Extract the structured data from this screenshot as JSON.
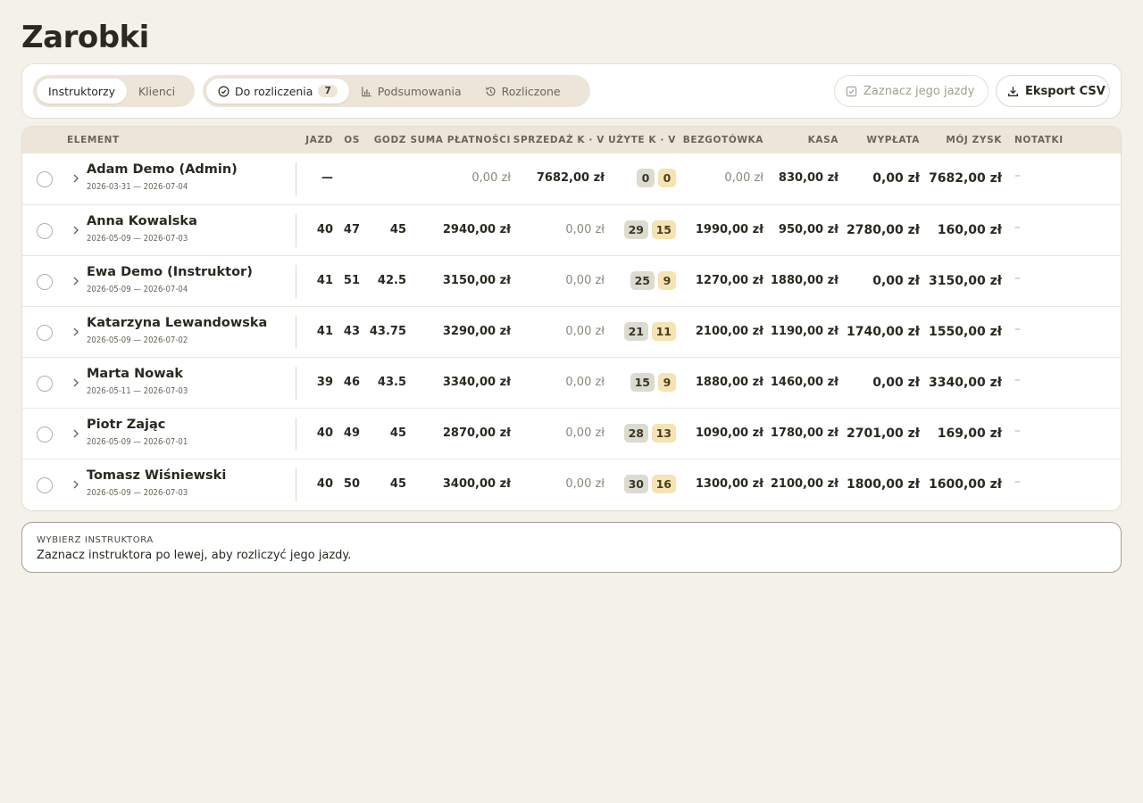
{
  "title": "Zarobki",
  "toolbar": {
    "scope_tabs": [
      {
        "label": "Instruktorzy",
        "active": true
      },
      {
        "label": "Klienci",
        "active": false
      }
    ],
    "view_tabs": [
      {
        "label": "Do rozliczenia",
        "count": "7",
        "icon": "check-circle-icon",
        "active": true
      },
      {
        "label": "Podsumowania",
        "icon": "bar-chart-icon",
        "active": false
      },
      {
        "label": "Rozliczone",
        "icon": "history-icon",
        "active": false
      }
    ],
    "mark_button": {
      "label": "Zaznacz jego jazdy",
      "icon": "checkbox-icon",
      "disabled": true
    },
    "export_button": {
      "label": "Eksport CSV",
      "icon": "download-icon"
    }
  },
  "table": {
    "headers": {
      "element": "ELEMENT",
      "jazd": "JAZD",
      "os": "OS",
      "godz": "GODZ",
      "suma": "SUMA PŁATNOŚCI",
      "sprzedaz": "SPRZEDAŻ K · V",
      "uzyte": "UŻYTE K · V",
      "bezgotowka": "BEZGOTÓWKA",
      "kasa": "KASA",
      "wyplata": "WYPŁATA",
      "zysk": "MÓJ ZYSK",
      "notatki": "NOTATKI"
    },
    "rows": [
      {
        "name": "Adam Demo (Admin)",
        "dates": "2026-03-31 — 2026-07-04",
        "jazd": "—",
        "os": "",
        "godz": "",
        "suma": "0,00 zł",
        "suma_muted": true,
        "sprzedaz": "7682,00 zł",
        "sprzedaz_muted": false,
        "uzyte_k": "0",
        "uzyte_v": "0",
        "bezgotowka": "0,00 zł",
        "bezgotowka_muted": true,
        "kasa": "830,00 zł",
        "wyplata": "0,00 zł",
        "zysk": "7682,00 zł",
        "notatki": "–"
      },
      {
        "name": "Anna Kowalska",
        "dates": "2026-05-09 — 2026-07-03",
        "jazd": "40",
        "os": "47",
        "godz": "45",
        "suma": "2940,00 zł",
        "suma_muted": false,
        "sprzedaz": "0,00 zł",
        "sprzedaz_muted": true,
        "uzyte_k": "29",
        "uzyte_v": "15",
        "bezgotowka": "1990,00 zł",
        "bezgotowka_muted": false,
        "kasa": "950,00 zł",
        "wyplata": "2780,00 zł",
        "zysk": "160,00 zł",
        "notatki": "–"
      },
      {
        "name": "Ewa Demo (Instruktor)",
        "dates": "2026-05-09 — 2026-07-04",
        "jazd": "41",
        "os": "51",
        "godz": "42.5",
        "suma": "3150,00 zł",
        "suma_muted": false,
        "sprzedaz": "0,00 zł",
        "sprzedaz_muted": true,
        "uzyte_k": "25",
        "uzyte_v": "9",
        "bezgotowka": "1270,00 zł",
        "bezgotowka_muted": false,
        "kasa": "1880,00 zł",
        "wyplata": "0,00 zł",
        "zysk": "3150,00 zł",
        "notatki": "–"
      },
      {
        "name": "Katarzyna Lewandowska",
        "dates": "2026-05-09 — 2026-07-02",
        "jazd": "41",
        "os": "43",
        "godz": "43.75",
        "suma": "3290,00 zł",
        "suma_muted": false,
        "sprzedaz": "0,00 zł",
        "sprzedaz_muted": true,
        "uzyte_k": "21",
        "uzyte_v": "11",
        "bezgotowka": "2100,00 zł",
        "bezgotowka_muted": false,
        "kasa": "1190,00 zł",
        "wyplata": "1740,00 zł",
        "zysk": "1550,00 zł",
        "notatki": "–"
      },
      {
        "name": "Marta Nowak",
        "dates": "2026-05-11 — 2026-07-03",
        "jazd": "39",
        "os": "46",
        "godz": "43.5",
        "suma": "3340,00 zł",
        "suma_muted": false,
        "sprzedaz": "0,00 zł",
        "sprzedaz_muted": true,
        "uzyte_k": "15",
        "uzyte_v": "9",
        "bezgotowka": "1880,00 zł",
        "bezgotowka_muted": false,
        "kasa": "1460,00 zł",
        "wyplata": "0,00 zł",
        "zysk": "3340,00 zł",
        "notatki": "–"
      },
      {
        "name": "Piotr Zając",
        "dates": "2026-05-09 — 2026-07-01",
        "jazd": "40",
        "os": "49",
        "godz": "45",
        "suma": "2870,00 zł",
        "suma_muted": false,
        "sprzedaz": "0,00 zł",
        "sprzedaz_muted": true,
        "uzyte_k": "28",
        "uzyte_v": "13",
        "bezgotowka": "1090,00 zł",
        "bezgotowka_muted": false,
        "kasa": "1780,00 zł",
        "wyplata": "2701,00 zł",
        "zysk": "169,00 zł",
        "notatki": "–"
      },
      {
        "name": "Tomasz Wiśniewski",
        "dates": "2026-05-09 — 2026-07-03",
        "jazd": "40",
        "os": "50",
        "godz": "45",
        "suma": "3400,00 zł",
        "suma_muted": false,
        "sprzedaz": "0,00 zł",
        "sprzedaz_muted": true,
        "uzyte_k": "30",
        "uzyte_v": "16",
        "bezgotowka": "1300,00 zł",
        "bezgotowka_muted": false,
        "kasa": "2100,00 zł",
        "wyplata": "1800,00 zł",
        "zysk": "1600,00 zł",
        "notatki": "–"
      }
    ]
  },
  "notice": {
    "title": "WYBIERZ INSTRUKTORA",
    "text": "Zaznacz instruktora po lewej, aby rozliczyć jego jazdy."
  },
  "colors": {
    "background": "#f4f1ea",
    "header_band": "#ece5d8",
    "pill_k": "#dcdbd0",
    "pill_v": "#f6e3b4"
  }
}
